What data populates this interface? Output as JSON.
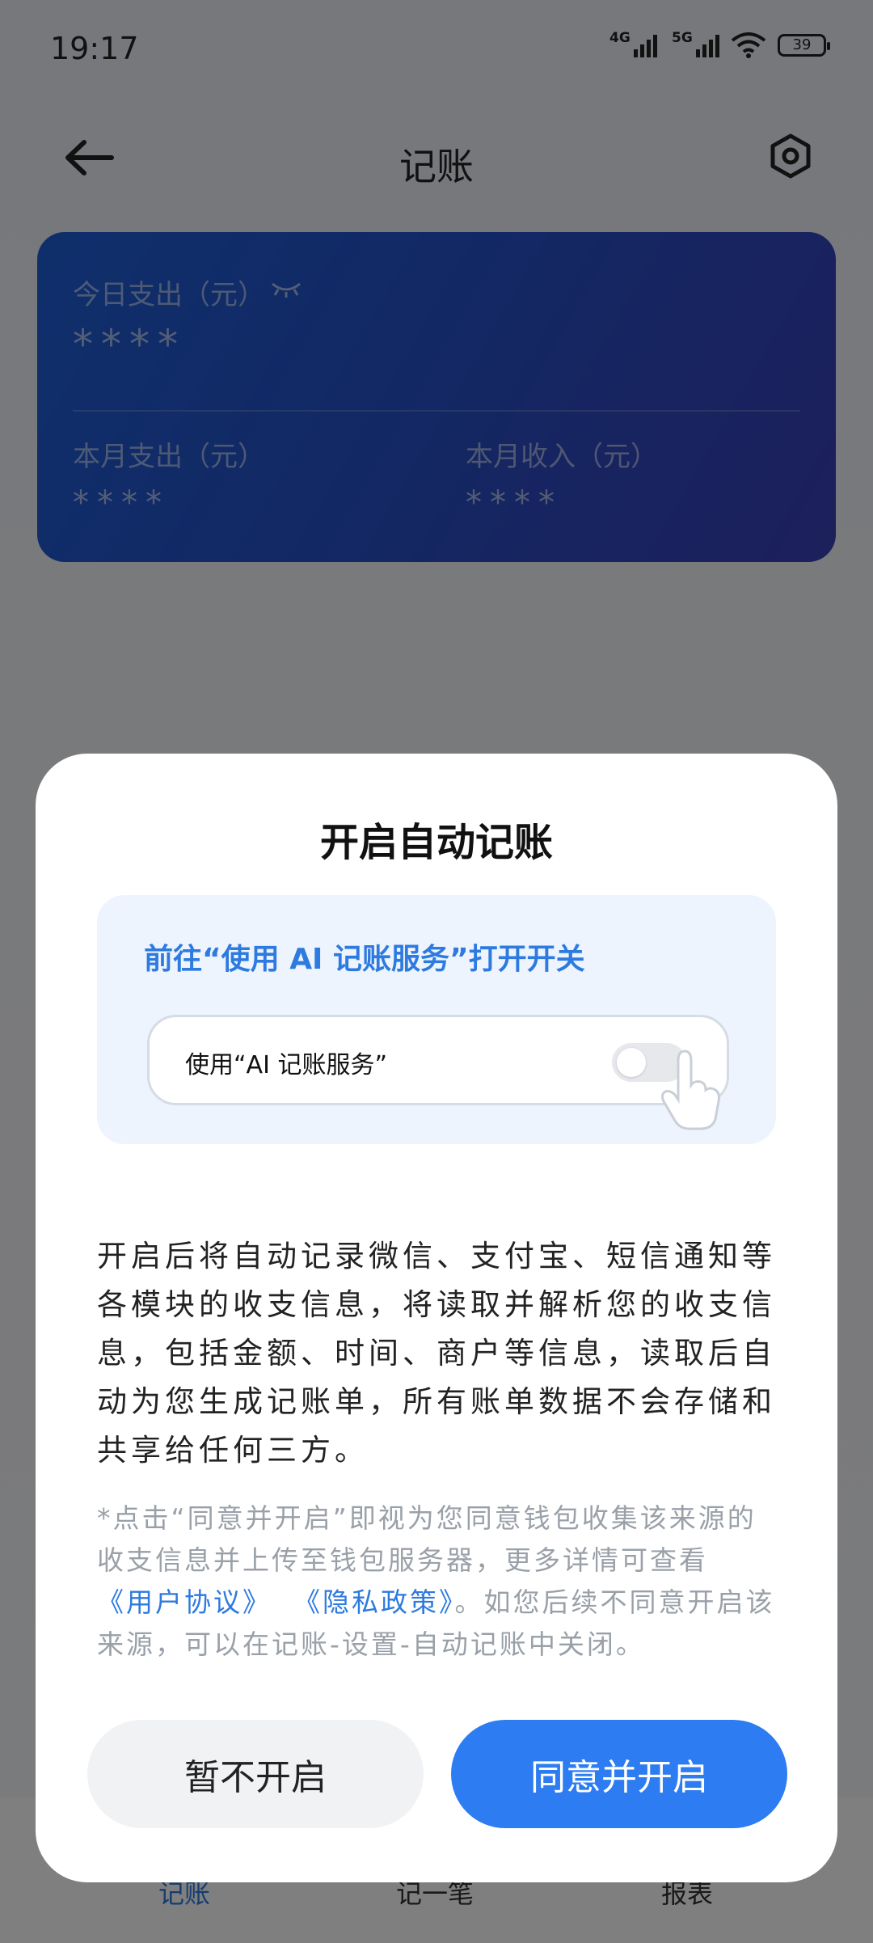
{
  "status_bar": {
    "time": "19:17",
    "net1": "4G",
    "net2": "5G",
    "battery": "39"
  },
  "header": {
    "title": "记账",
    "back_icon": "arrow-left-icon",
    "settings_icon": "hexagon-settings-icon"
  },
  "summary_card": {
    "today_label": "今日支出（元）",
    "today_value": "****",
    "month_expense_label": "本月支出（元）",
    "month_expense_value": "****",
    "month_income_label": "本月收入（元）",
    "month_income_value": "****"
  },
  "bottom_nav": {
    "items": [
      {
        "label": "记账"
      },
      {
        "label": "记一笔"
      },
      {
        "label": "报表"
      }
    ]
  },
  "dialog": {
    "title": "开启自动记账",
    "guide_text": "前往“使用 AI 记账服务”打开开关",
    "toggle_label": "使用“AI 记账服务”",
    "body": "开启后将自动记录微信、支付宝、短信通知等各模块的收支信息，将读取并解析您的收支信息，包括金额、时间、商户等信息，读取后自动为您生成记账单，所有账单数据不会存储和共享给任何三方。",
    "note_prefix": "*点击“同意并开启”即视为您同意钱包收集该来源的收支信息并上传至钱包服务器，更多详情可查看",
    "note_link1": "《用户协议》",
    "note_link2": "《隐私政策》",
    "note_suffix": "。如您后续不同意开启该来源，可以在记账-设置-自动记账中关闭。",
    "decline_button": "暂不开启",
    "accept_button": "同意并开启"
  }
}
